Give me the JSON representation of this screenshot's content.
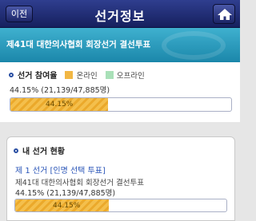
{
  "header": {
    "back_label": "이전",
    "title": "선거정보"
  },
  "banner": {
    "title": "제41대 대한의사협회 회장선거 결선투표"
  },
  "participation": {
    "heading": "선거 참여율",
    "legend_online": "온라인",
    "legend_offline": "오프라인",
    "rate": "44.15%",
    "count": "21,139",
    "total": "47,885명",
    "bar_label": "44.15%",
    "online_fraction": 0.4415
  },
  "my_status": {
    "heading": "내 선거 현황",
    "election_link": "제 1 선거 [인명 선택 투표]",
    "election_desc": "제41대 대한의사협회 회장선거 결선투표",
    "rate": "44.15%",
    "count": "21,139",
    "total": "47,885명",
    "bar_label": "44.15%",
    "fraction": 0.4415
  },
  "colors": {
    "online": "#f2b744",
    "offline": "#a9e0b8",
    "nav": "#1f2a73",
    "banner": "#2a9cc0"
  }
}
